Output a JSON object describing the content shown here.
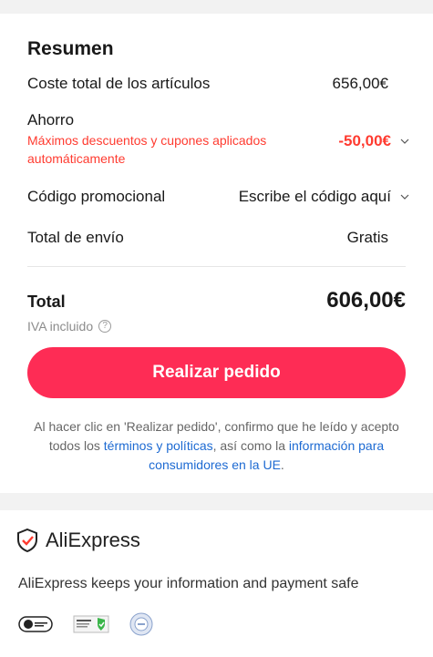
{
  "summary": {
    "title": "Resumen",
    "rows": {
      "items_total": {
        "label": "Coste total de los artículos",
        "value": "656,00€"
      },
      "savings": {
        "label": "Ahorro",
        "detail": "Máximos descuentos y cupones aplicados automáticamente",
        "value": "-50,00€"
      },
      "promo": {
        "label": "Código promocional",
        "value": "Escribe el código aquí"
      },
      "shipping": {
        "label": "Total de envío",
        "value": "Gratis"
      }
    },
    "total": {
      "label": "Total",
      "value": "606,00€",
      "vat_note": "IVA incluido"
    },
    "order_button": "Realizar pedido",
    "legal": {
      "part1": "Al hacer clic en 'Realizar pedido', confirmo que he leído y acepto todos los ",
      "link1": "términos y políticas",
      "part2": ", así como la ",
      "link2": "información para consumidores en la UE",
      "part3": "."
    }
  },
  "footer": {
    "brand": "AliExpress",
    "safe_text": "AliExpress keeps your information and payment safe",
    "badges": [
      "visa-secure-badge-icon",
      "ssl-secure-connection-badge-icon",
      "iso-certification-badge-icon"
    ]
  },
  "colors": {
    "accent": "#fe2c55",
    "discount": "#ff3b30",
    "link": "#1d6ad2"
  }
}
